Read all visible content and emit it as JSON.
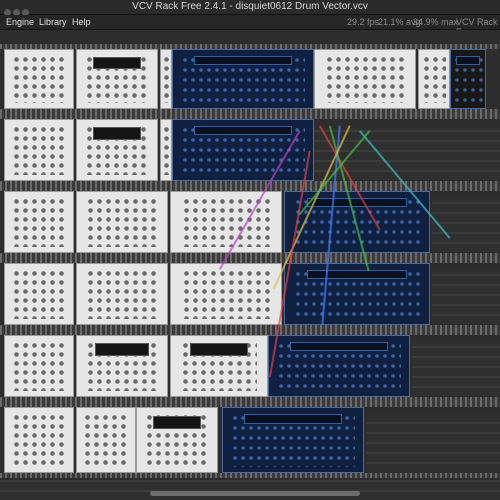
{
  "window": {
    "title": "VCV Rack Free 2.4.1 - disquiet0612 Drum Vector.vcv"
  },
  "menu": {
    "items": [
      "Engine",
      "Library",
      "Help"
    ]
  },
  "status": {
    "fps": "29.2 fps",
    "avg": "21.1% avg",
    "max": "34.9% max",
    "app": "VCV Rack Fr"
  },
  "colors": {
    "module_light": "#e6e6e6",
    "module_dark": "#102040",
    "rack_bg": "#2d2d2d",
    "cables": [
      "#e04040",
      "#40c040",
      "#4080ff",
      "#e0c040",
      "#c040c0",
      "#40c0c0"
    ]
  }
}
